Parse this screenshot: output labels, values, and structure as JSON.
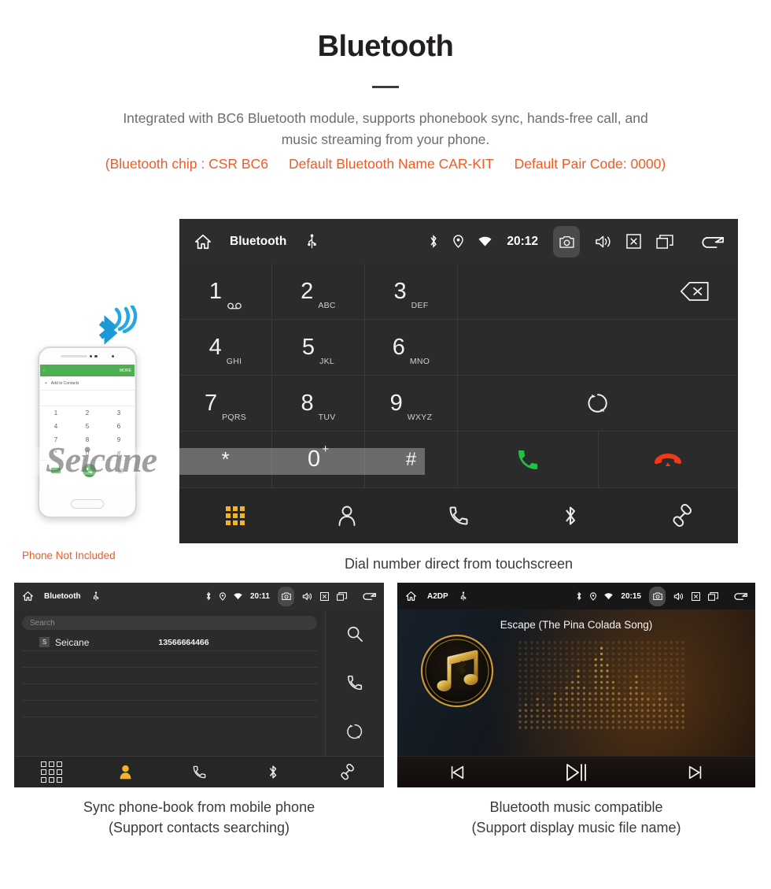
{
  "header": {
    "title": "Bluetooth",
    "intro_line1": "Integrated with BC6 Bluetooth module, supports phonebook sync, hands-free call, and",
    "intro_line2": "music streaming from your phone.",
    "spec_chip": "(Bluetooth chip : CSR BC6",
    "spec_name": "Default Bluetooth Name CAR-KIT",
    "spec_pair": "Default Pair Code: 0000)",
    "accent_color": "#f15a24",
    "body_color": "#6d6d6d"
  },
  "dialer": {
    "statusbar": {
      "title": "Bluetooth",
      "time": "20:12",
      "icons_left": [
        "home-icon",
        "usb-icon"
      ],
      "icons_right": [
        "bluetooth-icon",
        "location-icon",
        "wifi-icon",
        "camera-icon",
        "volume-icon",
        "close-box-icon",
        "recents-icon",
        "back-icon"
      ]
    },
    "keys": [
      {
        "num": "1",
        "sub": "",
        "glyph": "voicemail-icon"
      },
      {
        "num": "2",
        "sub": "ABC",
        "glyph": ""
      },
      {
        "num": "3",
        "sub": "DEF",
        "glyph": ""
      },
      {
        "num": "4",
        "sub": "GHI",
        "glyph": ""
      },
      {
        "num": "5",
        "sub": "JKL",
        "glyph": ""
      },
      {
        "num": "6",
        "sub": "MNO",
        "glyph": ""
      },
      {
        "num": "7",
        "sub": "PQRS",
        "glyph": ""
      },
      {
        "num": "8",
        "sub": "TUV",
        "glyph": ""
      },
      {
        "num": "9",
        "sub": "WXYZ",
        "glyph": ""
      },
      {
        "num": "*",
        "sub": "",
        "glyph": ""
      },
      {
        "num": "0",
        "sub": "",
        "glyph": "plus-superscript"
      },
      {
        "num": "#",
        "sub": "",
        "glyph": ""
      }
    ],
    "actions": {
      "backspace": "backspace-icon",
      "sync": "sync-icon",
      "call": "call-icon",
      "end_call": "end-call-icon",
      "call_color": "#20c140",
      "end_call_color": "#f03a17"
    },
    "nav": [
      "keypad-icon",
      "contacts-icon",
      "recent-calls-icon",
      "bluetooth-icon",
      "link-icon"
    ],
    "nav_active": "keypad-icon",
    "nav_active_color": "#f0b429",
    "caption": "Dial number direct from touchscreen"
  },
  "phone_illustration": {
    "appbar_more": "MORE",
    "add_contacts": "Add to Contacts",
    "keys": [
      "1",
      "2",
      "3",
      "4",
      "5",
      "6",
      "7",
      "8",
      "9",
      "*",
      "0",
      "#"
    ],
    "caption": "Phone Not Included",
    "caption_color": "#f15a24",
    "appbar_color": "#4caf50"
  },
  "watermark": {
    "text": "Seicane"
  },
  "phonebook": {
    "statusbar": {
      "title": "Bluetooth",
      "time": "20:11"
    },
    "search_placeholder": "Search",
    "columns": [
      "name",
      "number"
    ],
    "contacts": [
      {
        "badge": "S",
        "name": "Seicane",
        "number": "13566664466"
      }
    ],
    "empty_rows": 4,
    "side_actions": [
      "search-icon",
      "call-icon",
      "sync-icon"
    ],
    "nav": [
      "keypad-icon",
      "contacts-icon",
      "recent-calls-icon",
      "bluetooth-icon",
      "link-icon"
    ],
    "nav_active": "contacts-icon",
    "nav_active_color": "#f0b429",
    "caption_line1": "Sync phone-book from mobile phone",
    "caption_line2": "(Support contacts searching)"
  },
  "music": {
    "statusbar": {
      "title": "A2DP",
      "time": "20:15"
    },
    "song_title": "Escape (The Pina Colada Song)",
    "album_art": "bluetooth-music-note-icon",
    "visualizer": "dot-equalizer",
    "accent_color": "#d8a541",
    "controls": [
      "previous-track-icon",
      "play-pause-icon",
      "next-track-icon"
    ],
    "caption_line1": "Bluetooth music compatible",
    "caption_line2": "(Support display music file name)"
  }
}
